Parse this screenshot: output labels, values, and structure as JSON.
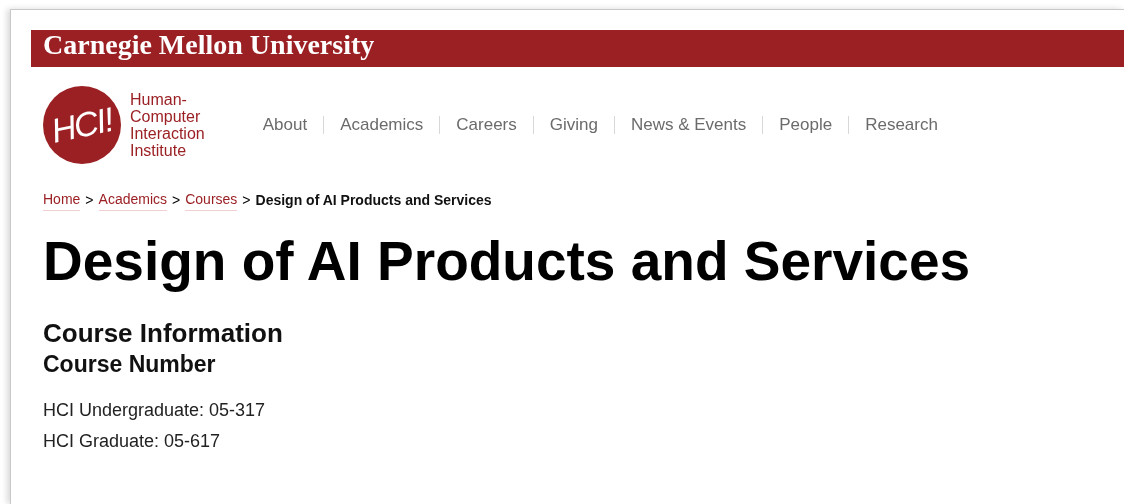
{
  "banner": {
    "title": "Carnegie Mellon University"
  },
  "logo": {
    "mark": "HCI!",
    "lines": [
      "Human-",
      "Computer",
      "Interaction",
      "Institute"
    ]
  },
  "nav": [
    "About",
    "Academics",
    "Careers",
    "Giving",
    "News & Events",
    "People",
    "Research"
  ],
  "breadcrumb": {
    "links": [
      "Home",
      "Academics",
      "Courses"
    ],
    "separator": ">",
    "current": "Design of AI Products and Services"
  },
  "page_title": "Design of AI Products and Services",
  "section_title": "Course Information",
  "subsection_title": "Course Number",
  "lines": [
    "HCI Undergraduate: 05-317",
    "HCI Graduate: 05-617"
  ]
}
